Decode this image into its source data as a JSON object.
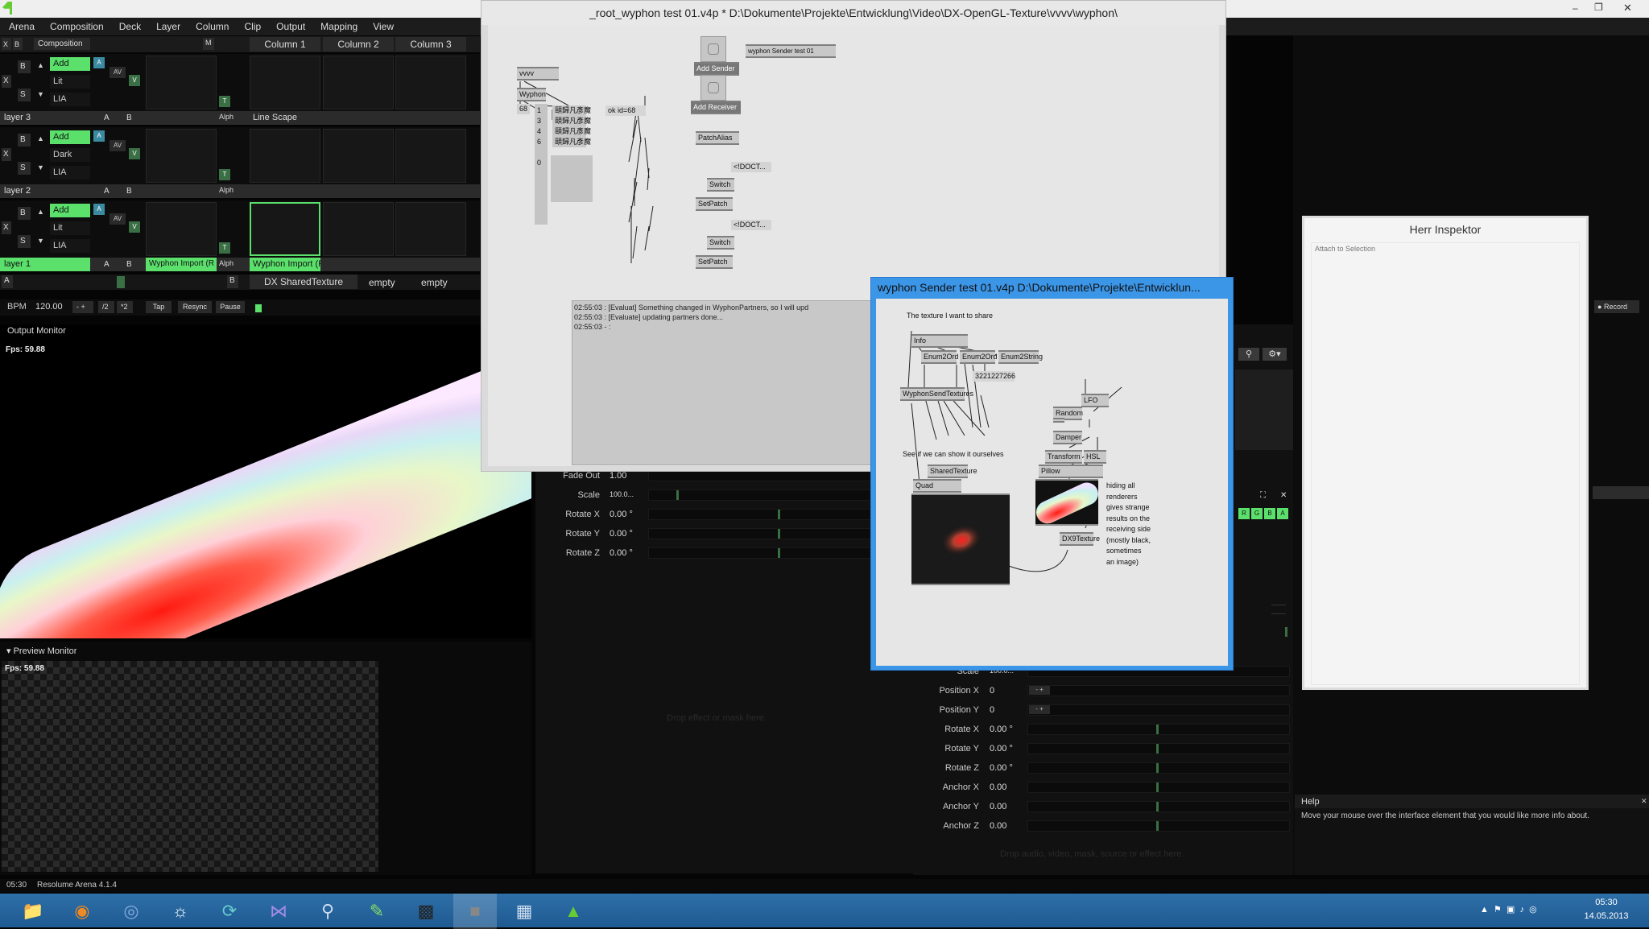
{
  "menu": [
    "Arena",
    "Composition",
    "Deck",
    "Layer",
    "Column",
    "Clip",
    "Output",
    "Mapping",
    "View"
  ],
  "columns": {
    "composition": "Composition",
    "m": "M",
    "col1": "Column 1",
    "col2": "Column 2",
    "col3": "Column 3"
  },
  "layers": [
    {
      "name": "layer 3",
      "blend": "Add",
      "mode1": "Lit",
      "mode2": "LIA",
      "clip1": "",
      "clip2": "Line Scape"
    },
    {
      "name": "layer 2",
      "blend": "Add",
      "mode1": "Dark",
      "mode2": "LIA",
      "clip1": "",
      "clip2": ""
    },
    {
      "name": "layer 1",
      "blend": "Add",
      "mode1": "Lit",
      "mode2": "LIA",
      "clip1": "Wyphon Import (R",
      "clip2": "Wyphon Import (R"
    }
  ],
  "layer_btns": {
    "x": "X",
    "b": "B",
    "s": "S",
    "a": "A",
    "bb": "B",
    "alph": "Alph",
    "av": "AV",
    "v": "V",
    "t": "T"
  },
  "deck": {
    "a": "A",
    "b": "B",
    "tab1": "DX SharedTexture",
    "tab2": "empty",
    "tab3": "empty"
  },
  "transport": {
    "bpm_label": "BPM",
    "bpm": "120.00",
    "minus": "- +",
    "div": "/2",
    "mul": "*2",
    "tap": "Tap",
    "resync": "Resync",
    "pause": "Pause"
  },
  "output_monitor": {
    "title": "Output Monitor",
    "fps": "Fps: 59.88"
  },
  "preview_monitor": {
    "title": "Preview Monitor",
    "fps": "Fps: 59.88"
  },
  "props_mid": [
    {
      "label": "Fade Out",
      "value": "1.00"
    },
    {
      "label": "Scale",
      "value": "100.0..."
    },
    {
      "label": "Rotate X",
      "value": "0.00 °"
    },
    {
      "label": "Rotate Y",
      "value": "0.00 °"
    },
    {
      "label": "Rotate Z",
      "value": "0.00 °"
    }
  ],
  "drop_effect": "Drop effect or mask here.",
  "props_right": [
    {
      "label": "Scale",
      "value": "100.0..."
    },
    {
      "label": "Position X",
      "value": "0"
    },
    {
      "label": "Position Y",
      "value": "0"
    },
    {
      "label": "Rotate X",
      "value": "0.00 °"
    },
    {
      "label": "Rotate Y",
      "value": "0.00 °"
    },
    {
      "label": "Rotate Z",
      "value": "0.00 °"
    },
    {
      "label": "Anchor X",
      "value": "0.00"
    },
    {
      "label": "Anchor Y",
      "value": "0.00"
    },
    {
      "label": "Anchor Z",
      "value": "0.00"
    }
  ],
  "drop_source": "Drop audio, video, mask, source or effect here.",
  "record": "Record",
  "rgba": [
    "R",
    "G",
    "B",
    "A"
  ],
  "inspector": {
    "title": "Herr Inspektor",
    "attach": "Attach to Selection"
  },
  "help": {
    "title": "Help",
    "text": "Move your mouse over the interface element that you would like more info about."
  },
  "status": {
    "time": "05:30",
    "app": "Resolume Arena 4.1.4"
  },
  "vvvv_main": {
    "title": "_root_wyphon test 01.v4p *  D:\\Dokumente\\Projekte\\Entwicklung\\Video\\DX-OpenGL-Texture\\vvvv\\wyphon\\",
    "nodes": {
      "vvvv": "vvvv",
      "wyphon": "Wyphon",
      "n68": "68",
      "okid": "ok id=68",
      "n1": "1",
      "n3": "3",
      "n4": "4",
      "n6": "6",
      "g1": "頤歸凡彥魔",
      "g2": "頤歸凡彥魔",
      "g3": "頤歸凡彥魔",
      "g4": "頤歸凡彥魔",
      "n0": "0",
      "add_sender": "Add Sender",
      "add_receiver": "Add Receiver",
      "sender_name": "wyphon Sender test 01",
      "patchalias": "PatchAlias",
      "doct1": "<!DOCT...",
      "switch1": "Switch",
      "setpatch1": "SetPatch",
      "doct2": "<!DOCT...",
      "switch2": "Switch",
      "setpatch2": "SetPatch"
    },
    "log": [
      "02:55:03    : [Evaluat] Something changed in WyphonPartners, so I will upd",
      "02:55:03    : [Evaluate] updating partners done...",
      "02:55:03  -  :"
    ]
  },
  "vvvv_sender": {
    "title": "wyphon Sender test 01.v4p    D:\\Dokumente\\Projekte\\Entwicklun...",
    "comment1": "The texture I want to share",
    "nodes": {
      "info": "Info",
      "enum2ord1": "Enum2Ord",
      "enum2ord2": "Enum2Ord",
      "enum2string": "Enum2String",
      "handle": "3221227266",
      "sendtextures": "WyphonSendTextures",
      "lfo": "LFO",
      "random": "Random",
      "damper": "Damper",
      "transform": "Transform",
      "hsl": "HSL",
      "pillow": "Pillow",
      "sharedtexture": "SharedTexture",
      "quad": "Quad",
      "dx9texture": "DX9Texture"
    },
    "comment2": "See if we can show it ourselves",
    "comment3": "hiding all renderers gives strange results on the receiving side (mostly black, sometimes an image)"
  },
  "taskbar": {
    "time": "05:30",
    "date": "14.05.2013",
    "apps": [
      "explorer-icon",
      "firefox-icon",
      "app3-icon",
      "alien-icon",
      "app5-icon",
      "visualstudio-icon",
      "search-icon",
      "notepad-icon",
      "cmd-icon",
      "vvvv-icon",
      "calc-icon",
      "arena-icon"
    ]
  }
}
